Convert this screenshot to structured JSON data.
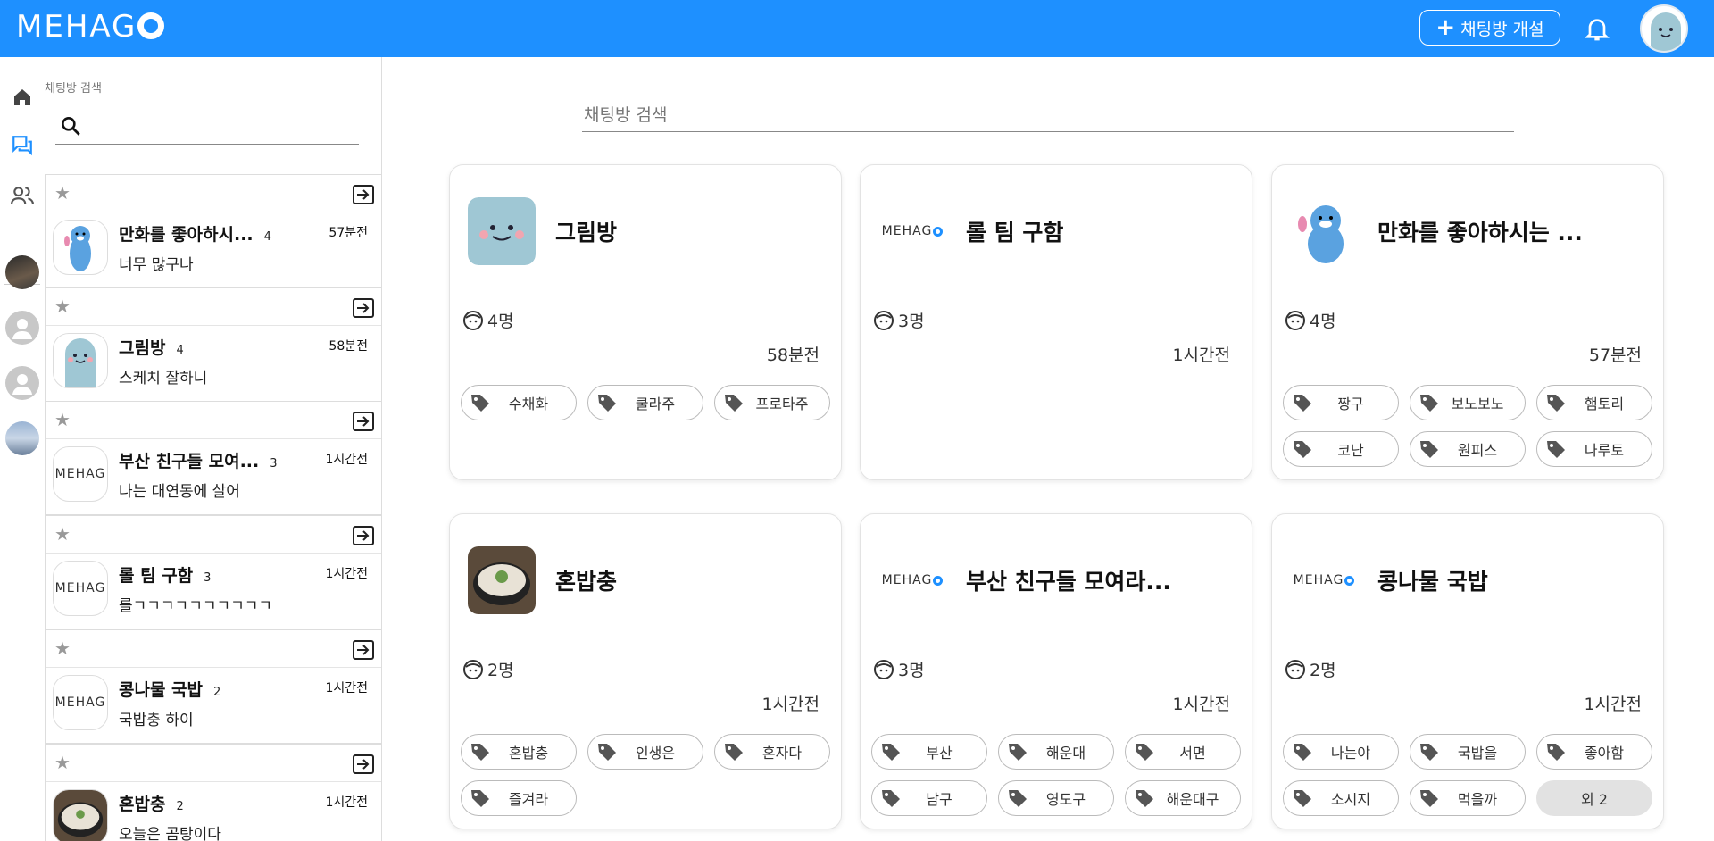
{
  "header": {
    "logo": "MEHAG",
    "open_room_label": "채팅방 개설"
  },
  "sidebar": {
    "search_label": "채팅방 검색",
    "rooms": [
      {
        "name": "만화를 좋아하시...",
        "count": "4",
        "time": "57분전",
        "message": "너무 많구나",
        "thumb": "seal-icon"
      },
      {
        "name": "그림방",
        "count": "4",
        "time": "58분전",
        "message": "스케치 잘하니",
        "thumb": "ghost-icon"
      },
      {
        "name": "부산 친구들 모여...",
        "count": "3",
        "time": "1시간전",
        "message": "나는 대연동에 살어",
        "thumb": "MEHAG"
      },
      {
        "name": "롤 팀 구함",
        "count": "3",
        "time": "1시간전",
        "message": "롤ㄱㄱㄱㄱㄱㄱㄱㄱㄱㄱ",
        "thumb": "MEHAG"
      },
      {
        "name": "콩나물 국밥",
        "count": "2",
        "time": "1시간전",
        "message": "국밥충 하이",
        "thumb": "MEHAG"
      },
      {
        "name": "혼밥충",
        "count": "2",
        "time": "1시간전",
        "message": "오늘은 곰탕이다",
        "thumb": "soup-icon"
      }
    ]
  },
  "main": {
    "search_label": "채팅방 검색",
    "cards": [
      {
        "title": "그림방",
        "members": "4명",
        "time": "58분전",
        "tags": [
          "수채화",
          "쿨라주",
          "프로타주"
        ]
      },
      {
        "title": "롤 팀 구함",
        "members": "3명",
        "time": "1시간전",
        "tags": []
      },
      {
        "title": "만화를 좋아하시는 ...",
        "members": "4명",
        "time": "57분전",
        "tags": [
          "짱구",
          "보노보노",
          "햄토리",
          "코난",
          "원피스",
          "나루토"
        ]
      },
      {
        "title": "혼밥충",
        "members": "2명",
        "time": "1시간전",
        "tags": [
          "혼밥충",
          "인생은",
          "혼자다",
          "즐겨라"
        ]
      },
      {
        "title": "부산 친구들 모여라...",
        "members": "3명",
        "time": "1시간전",
        "tags": [
          "부산",
          "해운대",
          "서면",
          "남구",
          "영도구",
          "해운대구"
        ]
      },
      {
        "title": "콩나물 국밥",
        "members": "2명",
        "time": "1시간전",
        "tags": [
          "나는야",
          "국밥을",
          "좋아함",
          "소시지",
          "먹을까"
        ],
        "more": "외 2"
      }
    ]
  },
  "colors": {
    "brand": "#1e90ff",
    "tag_border": "#bbbbbb"
  }
}
